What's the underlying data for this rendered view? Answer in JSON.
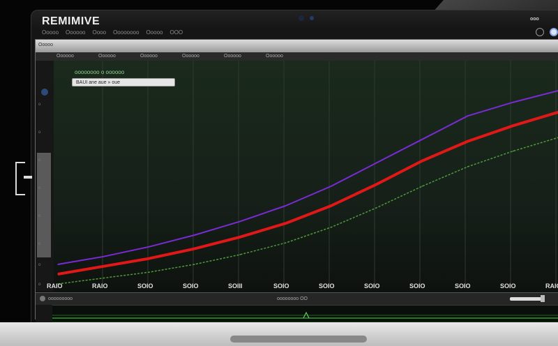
{
  "app": {
    "title": "REMIMIVE",
    "menu": [
      "Ooooo",
      "Oooooo",
      "Oooo",
      "Oooooooo",
      "Ooooo",
      "OOO"
    ],
    "top_right_text": "ooo"
  },
  "window": {
    "titlebar_text": "Ooooo",
    "tabs": [
      "Oooooo",
      "Oooooo",
      "Oooooo",
      "Oooooo",
      "Oooooo",
      "Oooooo"
    ],
    "subtitle": "oooooooo o oooooo",
    "search_value": "BAUI ane  aue  »  oue"
  },
  "left_axis": [
    "o",
    "o",
    "o",
    "o",
    "o",
    "o",
    "o",
    "o"
  ],
  "chart_data": {
    "type": "line",
    "x_ticks": [
      "RAIO",
      "RAIO",
      "SOIO",
      "SOIO",
      "SOIII",
      "SOIO",
      "SOIO",
      "SOIO",
      "SOIO",
      "SOIO",
      "SOIO",
      "RAIO"
    ],
    "series": [
      {
        "color": "#7a2bd6",
        "style": "solid",
        "values": [
          10,
          14,
          19,
          25,
          32,
          40,
          50,
          62,
          74,
          86,
          93,
          99
        ]
      },
      {
        "color": "#e01818",
        "style": "solid-thick",
        "values": [
          5,
          9,
          13,
          18,
          24,
          31,
          40,
          51,
          63,
          73,
          81,
          88
        ]
      },
      {
        "color": "#4f9a3c",
        "style": "dashed",
        "values": [
          0,
          3,
          6,
          10,
          15,
          21,
          29,
          39,
          50,
          60,
          68,
          75
        ]
      }
    ],
    "ylim": [
      0,
      100
    ],
    "grid": true
  },
  "bottom": {
    "label_left": "ooooooooo",
    "label_mid": "oooooooo  OO"
  },
  "colors": {
    "accent_blue": "#2d4a7a",
    "chart_bg": "#162019"
  }
}
